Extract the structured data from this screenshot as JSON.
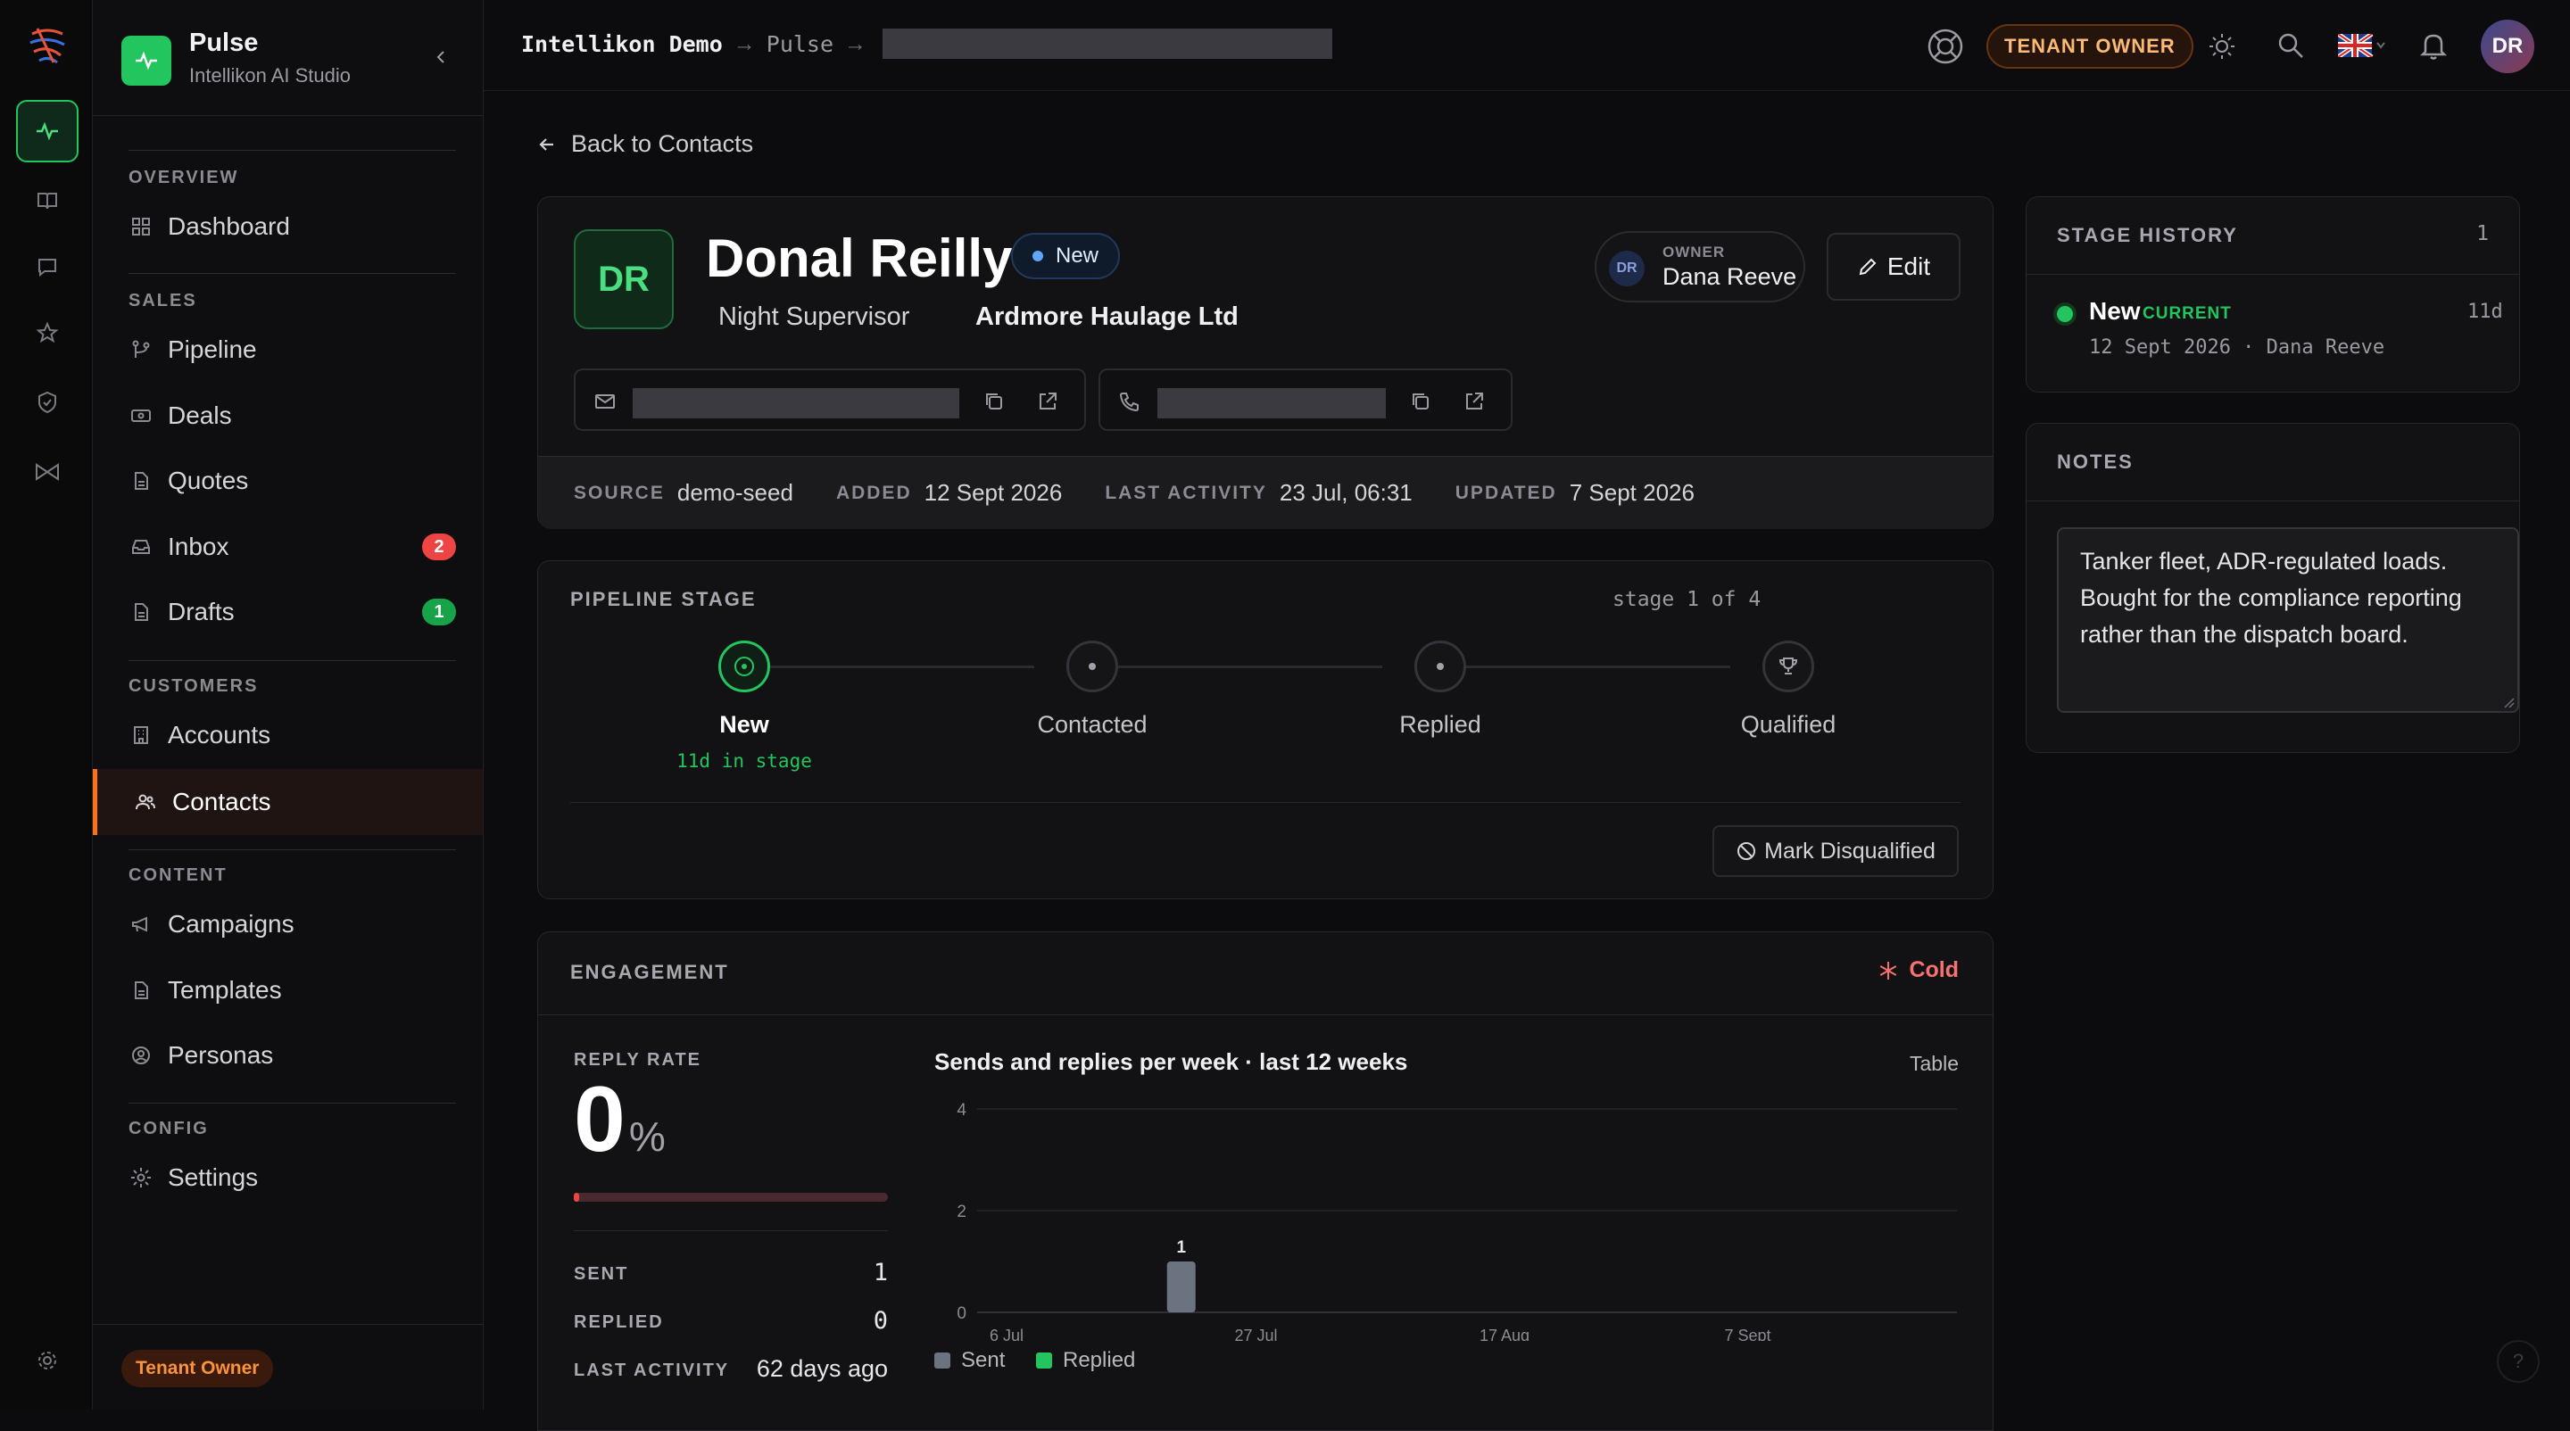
{
  "app": {
    "name": "Pulse",
    "subtitle": "Intellikon AI Studio"
  },
  "sidebar": {
    "sections": [
      {
        "label": "OVERVIEW",
        "items": [
          {
            "label": "Dashboard"
          }
        ]
      },
      {
        "label": "SALES",
        "items": [
          {
            "label": "Pipeline"
          },
          {
            "label": "Deals"
          },
          {
            "label": "Quotes"
          },
          {
            "label": "Inbox",
            "badge": "2"
          },
          {
            "label": "Drafts",
            "badge": "1"
          }
        ]
      },
      {
        "label": "CUSTOMERS",
        "items": [
          {
            "label": "Accounts"
          },
          {
            "label": "Contacts"
          }
        ]
      },
      {
        "label": "CONTENT",
        "items": [
          {
            "label": "Campaigns"
          },
          {
            "label": "Templates"
          },
          {
            "label": "Personas"
          }
        ]
      },
      {
        "label": "CONFIG",
        "items": [
          {
            "label": "Settings"
          }
        ]
      }
    ],
    "active": "Contacts",
    "footer_role": "Tenant Owner"
  },
  "topbar": {
    "breadcrumbs": [
      "Intellikon Demo",
      "Pulse"
    ],
    "role_button": "TENANT OWNER",
    "avatar_initials": "DR",
    "icons": [
      "support-icon",
      "sun-icon",
      "search-icon",
      "uk-flag-icon",
      "bell-icon"
    ]
  },
  "back_link": "Back to Contacts",
  "contact": {
    "initials": "DR",
    "name": "Donal Reilly",
    "status": "New",
    "job_title": "Night Supervisor",
    "company": "Ardmore Haulage Ltd",
    "owner_label": "OWNER",
    "owner_initials": "DR",
    "owner_name": "Dana Reeve",
    "edit_label": "Edit",
    "meta": [
      {
        "key": "SOURCE",
        "value": "demo-seed"
      },
      {
        "key": "ADDED",
        "value": "12 Sept 2026"
      },
      {
        "key": "LAST ACTIVITY",
        "value": "23 Jul, 06:31"
      },
      {
        "key": "UPDATED",
        "value": "7 Sept 2026"
      }
    ]
  },
  "pipeline": {
    "label": "PIPELINE STAGE",
    "counter": "stage 1 of 4",
    "stages": [
      "New",
      "Contacted",
      "Replied",
      "Qualified"
    ],
    "current_note": "11d in stage",
    "disqualify_label": "Mark Disqualified"
  },
  "engagement": {
    "label": "ENGAGEMENT",
    "temperature": "Cold",
    "reply_rate_label": "REPLY RATE",
    "reply_rate_value": "0",
    "reply_rate_unit": "%",
    "reply_rate_fraction": 0.0,
    "stats": [
      {
        "key": "SENT",
        "value": "1"
      },
      {
        "key": "REPLIED",
        "value": "0"
      },
      {
        "key": "LAST ACTIVITY",
        "value": "62 days ago"
      }
    ],
    "table_toggle": "Table"
  },
  "chart_data": {
    "type": "bar",
    "title": "Sends and replies per week · last 12 weeks",
    "x_ticks": [
      "6 Jul",
      "27 Jul",
      "17 Aug",
      "7 Sept"
    ],
    "weeks": 12,
    "series": [
      {
        "name": "Sent",
        "color": "#6b7280",
        "values": [
          0,
          0,
          1,
          0,
          0,
          0,
          0,
          0,
          0,
          0,
          0,
          0
        ]
      },
      {
        "name": "Replied",
        "color": "#22c55e",
        "values": [
          0,
          0,
          0,
          0,
          0,
          0,
          0,
          0,
          0,
          0,
          0,
          0
        ]
      }
    ],
    "data_labels": [
      {
        "week_index": 2,
        "series": "Sent",
        "label": "1"
      }
    ],
    "ylim": [
      0,
      4
    ],
    "y_ticks": [
      "0",
      "2",
      "4"
    ],
    "grid": true,
    "legend": "bottom-left"
  },
  "stage_history": {
    "label": "STAGE HISTORY",
    "count": "1",
    "items": [
      {
        "stage": "New",
        "tag": "CURRENT",
        "age": "11d",
        "detail": "12 Sept 2026 · Dana Reeve"
      }
    ]
  },
  "notes": {
    "label": "NOTES",
    "text": "Tanker fleet, ADR-regulated loads. Bought for the compliance reporting rather than the dispatch board."
  },
  "colors": {
    "accent": "#22c55e",
    "active_nav": "#f97316",
    "badge_red": "#ef4444",
    "badge_green": "#16a34a",
    "cold": "#f87171"
  }
}
